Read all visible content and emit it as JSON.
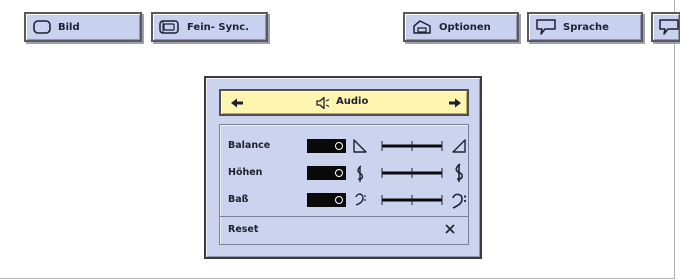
{
  "top_tabs": [
    {
      "label": "Bild",
      "icon": "monitor-icon"
    },
    {
      "label": "Fein- Sync.",
      "icon": "fine-sync-icon"
    },
    {
      "label": "Optionen",
      "icon": "options-icon"
    },
    {
      "label": "Sprache",
      "icon": "speech-bubble-icon"
    }
  ],
  "audio_menu": {
    "title": "Audio",
    "title_icon": "speaker-icon",
    "left_arrow": "arrow-left-icon",
    "right_arrow": "arrow-right-icon",
    "rows": [
      {
        "label": "Balance",
        "min_icon": "balance-left-icon",
        "max_icon": "balance-right-icon"
      },
      {
        "label": "Höhen",
        "min_icon": "treble-clef-icon",
        "max_icon": "treble-clef-icon"
      },
      {
        "label": "Baß",
        "min_icon": "bass-clef-icon",
        "max_icon": "bass-clef-icon"
      }
    ],
    "reset_label": "Reset",
    "reset_icon": "close-icon"
  },
  "colors": {
    "tab_fill": "#c8d2f0",
    "menu_fill": "#cbd3ee",
    "header_fill": "#fff4b0",
    "value_box": "#0a0a0a"
  }
}
